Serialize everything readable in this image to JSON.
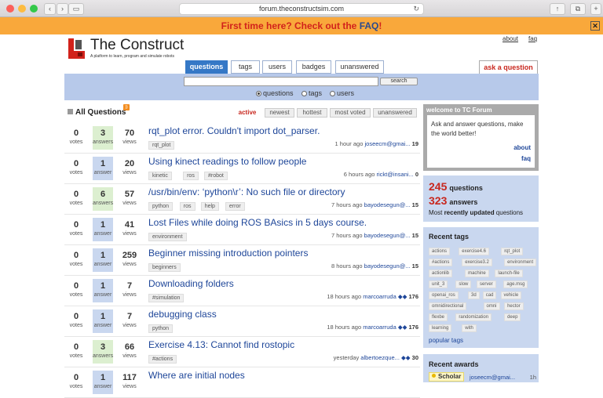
{
  "browser": {
    "url": "forum.theconstructsim.com",
    "back": "‹",
    "forward": "›",
    "share": "↑",
    "tabs": "⧉",
    "newtab": "+"
  },
  "banner": {
    "text": "First time here? Check out the ",
    "faq": "FAQ",
    "end": "!",
    "close": "✕"
  },
  "site": {
    "name": "The Construct",
    "tagline": "A platform to learn, program and simulate robots"
  },
  "toplinks": {
    "about": "about",
    "faq": "faq"
  },
  "nav": {
    "tabs": [
      "questions",
      "tags",
      "users",
      "badges",
      "unanswered"
    ],
    "ask": "ask a question"
  },
  "search": {
    "button": "search",
    "scopes": [
      "questions",
      "tags",
      "users"
    ]
  },
  "list": {
    "heading": "All Questions",
    "rss": "))",
    "sorts": [
      "active",
      "newest",
      "hottest",
      "most voted",
      "unanswered"
    ],
    "labels": {
      "votes": "votes",
      "answers": "answers",
      "answer": "answer",
      "views": "views"
    },
    "questions": [
      {
        "votes": "0",
        "answers": "3",
        "answers_label": "answers",
        "views": "70",
        "title": "rqt_plot error. Couldn't import dot_parser.",
        "tags": [
          "rqt_plot"
        ],
        "time": "1 hour ago",
        "user": "joseecm@gmai...",
        "rep": "19",
        "diamonds": ""
      },
      {
        "votes": "0",
        "answers": "1",
        "answers_label": "answer",
        "views": "20",
        "title": "Using kinect readings to follow people",
        "tags": [
          "kinetic",
          "ros",
          "#robot"
        ],
        "time": "6 hours ago",
        "user": "rickt@insani...",
        "rep": "0",
        "diamonds": ""
      },
      {
        "votes": "0",
        "answers": "6",
        "answers_label": "answers",
        "views": "57",
        "title": "/usr/bin/env: ‘python\\r’: No such file or directory",
        "tags": [
          "python",
          "ros",
          "help",
          "error"
        ],
        "time": "7 hours ago",
        "user": "bayodesegun@...",
        "rep": "15",
        "diamonds": ""
      },
      {
        "votes": "0",
        "answers": "1",
        "answers_label": "answer",
        "views": "41",
        "title": "Lost Files while doing ROS BAsics in 5 days course.",
        "tags": [
          "environment"
        ],
        "time": "7 hours ago",
        "user": "bayodesegun@...",
        "rep": "15",
        "diamonds": ""
      },
      {
        "votes": "0",
        "answers": "1",
        "answers_label": "answer",
        "views": "259",
        "title": "Beginner missing introduction pointers",
        "tags": [
          "beginners"
        ],
        "time": "8 hours ago",
        "user": "bayodesegun@...",
        "rep": "15",
        "diamonds": ""
      },
      {
        "votes": "0",
        "answers": "1",
        "answers_label": "answer",
        "views": "7",
        "title": "Downloading folders",
        "tags": [
          "#simulation"
        ],
        "time": "18 hours ago",
        "user": "marcoarruda",
        "rep": "176",
        "diamonds": "◆◆"
      },
      {
        "votes": "0",
        "answers": "1",
        "answers_label": "answer",
        "views": "7",
        "title": "debugging class",
        "tags": [
          "python"
        ],
        "time": "18 hours ago",
        "user": "marcoarruda",
        "rep": "176",
        "diamonds": "◆◆"
      },
      {
        "votes": "0",
        "answers": "3",
        "answers_label": "answers",
        "views": "66",
        "title": "Exercise 4.13: Cannot find rostopic",
        "tags": [
          "#actions"
        ],
        "time": "yesterday",
        "user": "albertoezque...",
        "rep": "30",
        "diamonds": "◆◆"
      },
      {
        "votes": "0",
        "answers": "1",
        "answers_label": "answer",
        "views": "117",
        "title": "Where are initial nodes",
        "tags": [],
        "time": "",
        "user": "",
        "rep": "",
        "diamonds": ""
      }
    ]
  },
  "welcome": {
    "heading": "welcome to TC Forum",
    "text": "Ask and answer questions, make the world better!",
    "about": "about",
    "faq": "faq"
  },
  "stats": {
    "questions": "245",
    "questions_label": "questions",
    "answers": "323",
    "answers_label": "answers",
    "updated": "Most recently updated questions",
    "updated_prefix": "Most ",
    "updated_bold": "recently updated",
    "updated_suffix": " questions"
  },
  "recent_tags": {
    "heading": "Recent tags",
    "rows": [
      [
        "actions",
        "exercise4.6",
        "rqt_plot"
      ],
      [
        "#actions",
        "exercise3.2",
        "environment"
      ],
      [
        "actionlib",
        "machine",
        "launch-file"
      ],
      [
        "unit_3",
        "slow",
        "server",
        "age.msg"
      ],
      [
        "openai_ros",
        "3d",
        "cad",
        "vehicle"
      ],
      [
        "omnidirectional",
        "omni",
        "hector"
      ],
      [
        "flexbe",
        "randomization",
        "deep"
      ],
      [
        "learning",
        "with"
      ]
    ],
    "popular": "popular tags"
  },
  "awards": {
    "heading": "Recent awards",
    "badge": "Scholar",
    "user": "joseecm@gmai...",
    "time": "1h"
  },
  "colors": {
    "accent": "#3578c6",
    "banner": "#f9a83b",
    "link": "#1e4699",
    "alert": "#c8271e",
    "panel": "#c9d7ef"
  }
}
